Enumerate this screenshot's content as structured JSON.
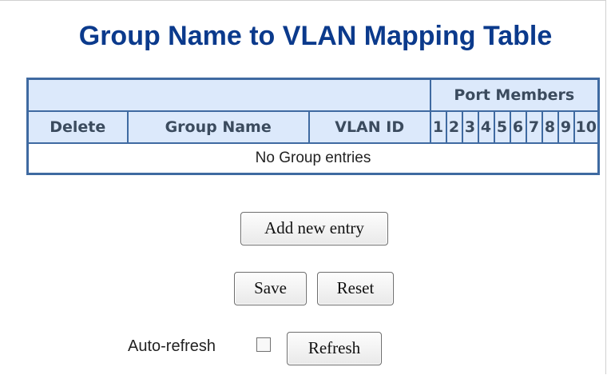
{
  "page": {
    "title": "Group Name to VLAN Mapping Table"
  },
  "table": {
    "group_header": "Port Members",
    "columns": [
      "Delete",
      "Group Name",
      "VLAN ID"
    ],
    "ports": [
      "1",
      "2",
      "3",
      "4",
      "5",
      "6",
      "7",
      "8",
      "9",
      "10"
    ],
    "empty_message": "No Group entries"
  },
  "buttons": {
    "add": "Add new entry",
    "save": "Save",
    "reset": "Reset",
    "refresh": "Refresh"
  },
  "auto_refresh": {
    "label": "Auto-refresh",
    "checked": false
  },
  "colors": {
    "title": "#0b3a8c",
    "header_bg": "#dce9fb",
    "border": "#3f6aa1"
  }
}
